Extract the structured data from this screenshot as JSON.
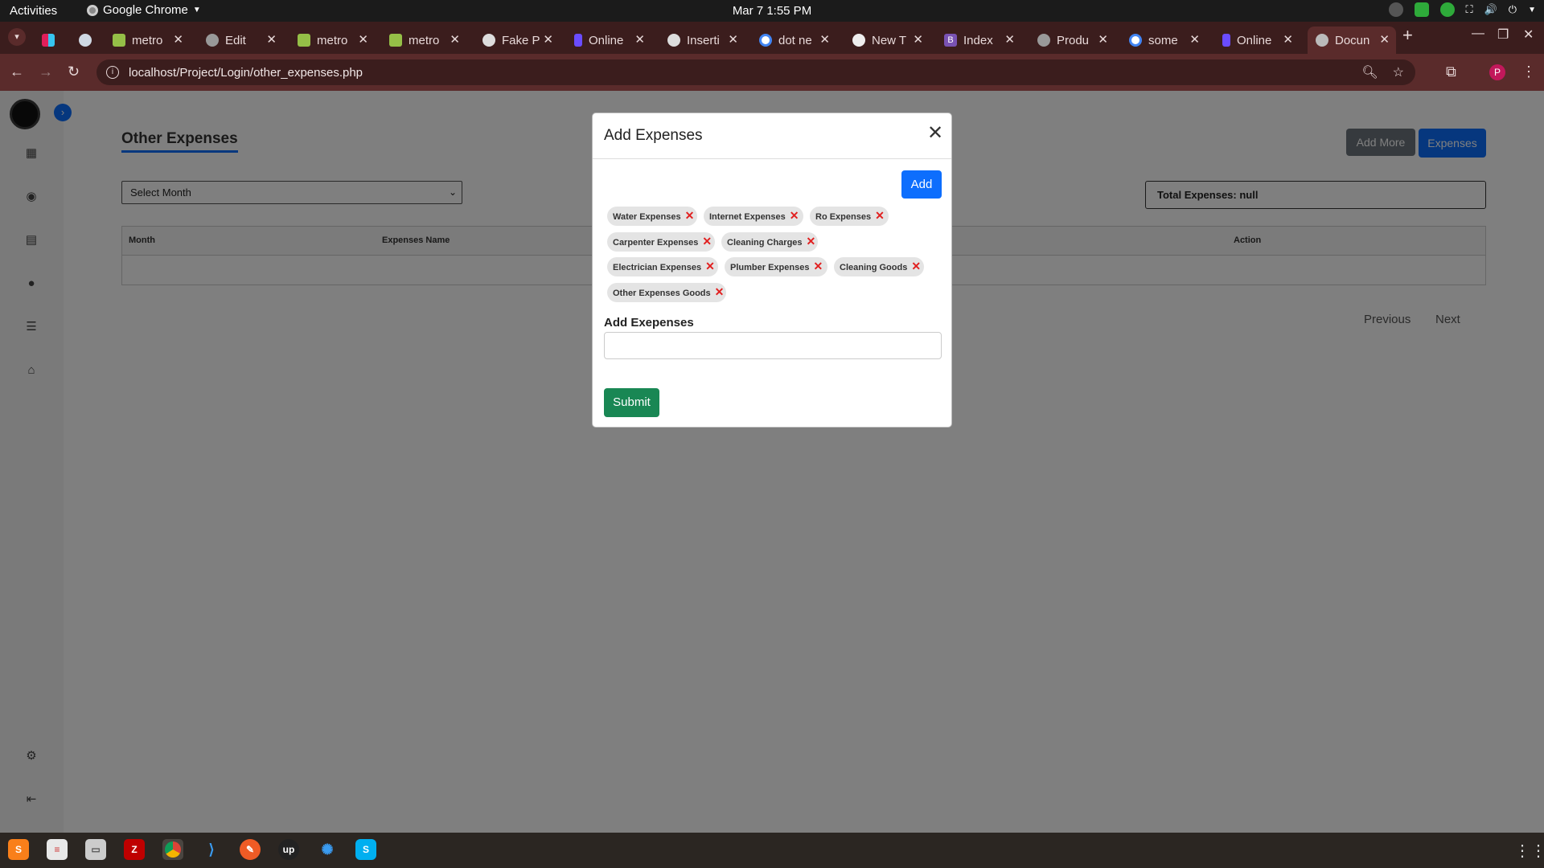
{
  "topbar": {
    "activities": "Activities",
    "app_name": "Google Chrome",
    "clock": "Mar 7  1:55 PM"
  },
  "tabs": [
    {
      "label": ""
    },
    {
      "label": ""
    },
    {
      "label": "metro"
    },
    {
      "label": "Edit"
    },
    {
      "label": "metro"
    },
    {
      "label": "metro"
    },
    {
      "label": "Fake P"
    },
    {
      "label": "Online"
    },
    {
      "label": "Inserti"
    },
    {
      "label": "dot ne"
    },
    {
      "label": "New T"
    },
    {
      "label": "Index"
    },
    {
      "label": "Produ"
    },
    {
      "label": "some"
    },
    {
      "label": "Online"
    },
    {
      "label": "Docun"
    }
  ],
  "toolbar": {
    "url": "localhost/Project/Login/other_expenses.php",
    "profile_initial": "P"
  },
  "page": {
    "heading": "Other Expenses",
    "add_more_label": "Add More",
    "expenses_label": "Expenses",
    "month_select": "Select Month",
    "total": "Total Expenses: null",
    "table_headers": {
      "month": "Month",
      "name": "Expenses Name",
      "action": "Action"
    },
    "previous": "Previous",
    "next": "Next"
  },
  "modal": {
    "title": "Add Expenses",
    "add_label": "Add",
    "chips": [
      "Water Expenses",
      "Internet Expenses",
      "Ro Expenses",
      "Carpenter Expenses",
      "Cleaning Charges",
      "Electrician Expenses",
      "Plumber Expenses",
      "Cleaning Goods",
      "Other Expenses Goods"
    ],
    "field_label": "Add Exepenses",
    "field_value": "",
    "submit_label": "Submit"
  },
  "colors": {
    "primary": "#0d6efd",
    "success": "#198754",
    "secondary": "#6c757d",
    "chip_remove": "#e12020",
    "chrome_frame": "#3b1d1d"
  },
  "icons": {
    "sidebar": [
      "dashboard-icon",
      "user-icon",
      "document-icon",
      "chat-icon",
      "database-icon",
      "home-icon",
      "settings-icon",
      "logout-icon"
    ]
  }
}
